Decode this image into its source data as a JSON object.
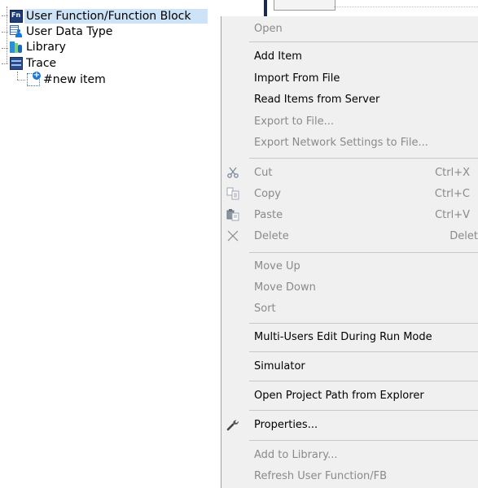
{
  "tree": {
    "items": [
      {
        "label": "User Function/Function Block",
        "icon": "function-block-icon",
        "selected": true
      },
      {
        "label": "User Data Type",
        "icon": "data-type-icon"
      },
      {
        "label": "Library",
        "icon": "library-icon"
      },
      {
        "label": "Trace",
        "icon": "trace-icon"
      },
      {
        "label": "#new item",
        "icon": "new-item-icon"
      }
    ],
    "fn_icon_text": "Fn"
  },
  "menu": {
    "items": [
      {
        "label": "Open",
        "enabled": false
      },
      {
        "label": "Add Item",
        "enabled": true,
        "submenu": true
      },
      {
        "label": "Import From File",
        "enabled": true,
        "submenu": true
      },
      {
        "label": "Read Items from Server",
        "enabled": true
      },
      {
        "label": "Export to File...",
        "enabled": false
      },
      {
        "label": "Export Network Settings to File...",
        "enabled": false
      },
      {
        "label": "Cut",
        "shortcut": "Ctrl+X",
        "enabled": false,
        "icon": "scissors-icon"
      },
      {
        "label": "Copy",
        "shortcut": "Ctrl+C",
        "enabled": false,
        "icon": "copy-icon"
      },
      {
        "label": "Paste",
        "shortcut": "Ctrl+V",
        "enabled": false,
        "icon": "paste-icon"
      },
      {
        "label": "Delete",
        "shortcut": "Delete",
        "enabled": false,
        "icon": "delete-icon"
      },
      {
        "label": "Move Up",
        "enabled": false
      },
      {
        "label": "Move Down",
        "enabled": false
      },
      {
        "label": "Sort",
        "enabled": false
      },
      {
        "label": "Multi-Users Edit During Run Mode",
        "enabled": true,
        "submenu": true
      },
      {
        "label": "Simulator",
        "enabled": true,
        "submenu": true
      },
      {
        "label": "Open Project Path from Explorer",
        "enabled": true
      },
      {
        "label": "Properties...",
        "enabled": true,
        "icon": "wrench-icon"
      },
      {
        "label": "Add to Library...",
        "enabled": false
      },
      {
        "label": "Refresh User Function/FB",
        "enabled": false
      }
    ],
    "submenu_arrow": "▸"
  },
  "colors": {
    "selection": "#cde3f7",
    "menu_bg": "#f0f0f0",
    "disabled_text": "#8a8a8a"
  }
}
